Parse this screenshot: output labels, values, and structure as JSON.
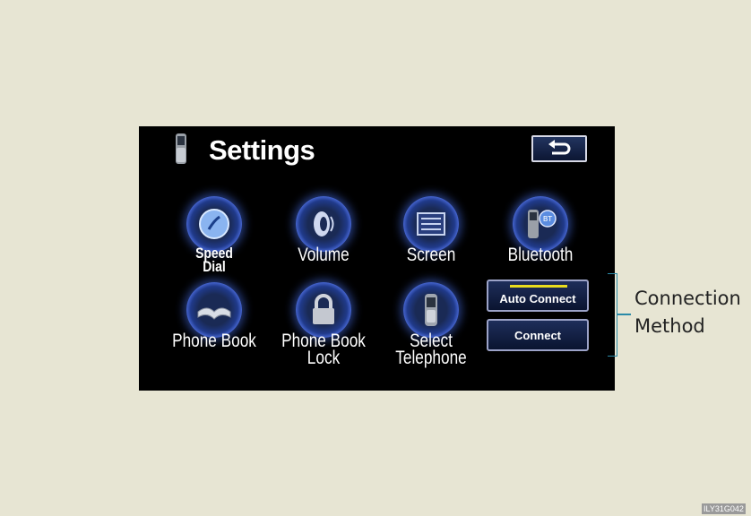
{
  "screen": {
    "title": "Settings",
    "tiles": [
      {
        "id": "speed-dial",
        "line1": "Speed",
        "line2": "Dial",
        "icon": "speed-dial-icon"
      },
      {
        "id": "volume",
        "line1": "Volume",
        "line2": "",
        "icon": "speaker-icon"
      },
      {
        "id": "screen",
        "line1": "Screen",
        "line2": "",
        "icon": "screen-settings-icon"
      },
      {
        "id": "bluetooth",
        "line1": "Bluetooth",
        "line2": "",
        "icon": "bluetooth-phone-icon"
      },
      {
        "id": "phone-book",
        "line1": "Phone Book",
        "line2": "",
        "icon": "book-icon"
      },
      {
        "id": "phone-book-lock",
        "line1": "Phone Book",
        "line2": "Lock",
        "icon": "padlock-icon"
      },
      {
        "id": "select-telephone",
        "line1": "Select",
        "line2": "Telephone",
        "icon": "mobile-phone-icon"
      }
    ],
    "buttons": {
      "auto_connect": "Auto Connect",
      "connect": "Connect"
    },
    "auto_connect_active_color": "#e8dc1e"
  },
  "callout": {
    "line1": "Connection",
    "line2": "Method"
  },
  "figure_code": "ILY31G042"
}
